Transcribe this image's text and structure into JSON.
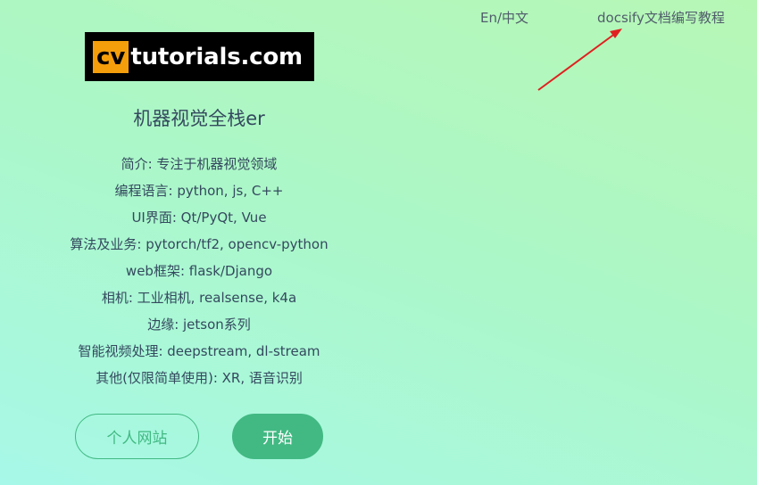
{
  "nav": {
    "lang_link": "En/中文",
    "docs_link": "docsify文档编写教程"
  },
  "logo": {
    "cv": "cv",
    "rest": "tutorials.com"
  },
  "cover": {
    "title": "机器视觉全栈er",
    "descriptions": [
      "简介:  专注于机器视觉领域",
      "编程语言: python, js, C++",
      "UI界面: Qt/PyQt, Vue",
      "算法及业务: pytorch/tf2, opencv-python",
      "web框架: flask/Django",
      "相机: 工业相机, realsense, k4a",
      "边缘: jetson系列",
      "智能视频处理:  deepstream, dl-stream",
      "其他(仅限简单使用): XR, 语音识别"
    ]
  },
  "buttons": {
    "personal_site": "个人网站",
    "start": "开始"
  },
  "colors": {
    "accent": "#42b983",
    "annotation_arrow": "#e02020",
    "logo_orange": "#f59e0b"
  }
}
